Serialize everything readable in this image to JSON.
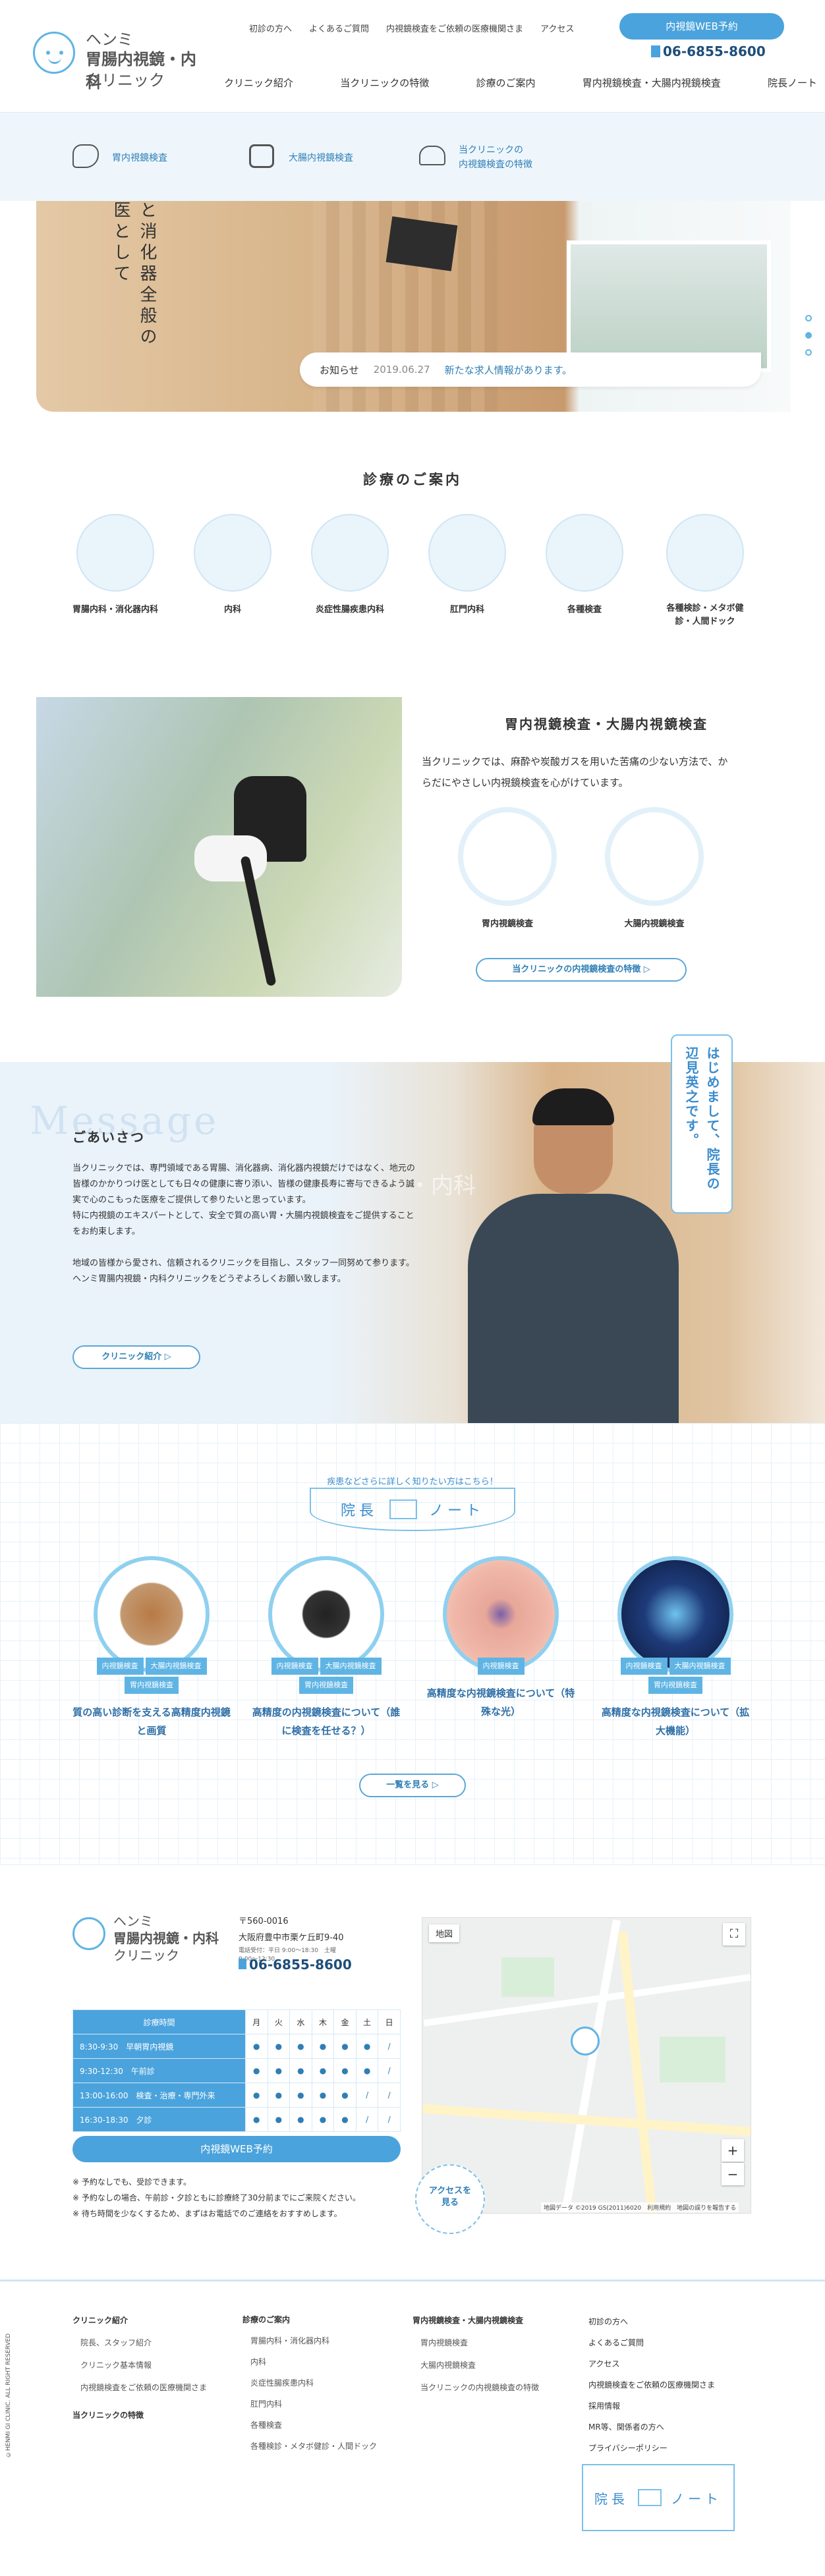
{
  "header": {
    "logo_line1": "ヘンミ",
    "logo_line2": "胃腸内視鏡・内科",
    "logo_line3": "クリニック",
    "top_links": [
      "初診の方へ",
      "よくあるご質問",
      "内視鏡検査をご依頼の医療機関さま",
      "アクセス"
    ],
    "web_button": "内視鏡WEB予約",
    "phone": "06-6855-8600",
    "nav": [
      "クリニック紹介",
      "当クリニックの特徴",
      "診療のご案内",
      "胃内視鏡検査・大腸内視鏡検査",
      "院長ノート"
    ]
  },
  "subnav": [
    "胃内視鏡検査",
    "大腸内視鏡検査",
    "当クリニックの\n内視鏡検査の特徴"
  ],
  "hero": {
    "vertical_text_1": "と消化器全般の",
    "vertical_text_2": "医として",
    "news_label": "お知らせ",
    "news_date": "2019.06.27",
    "news_text": "新たな求人情報があります。"
  },
  "services": {
    "title": "診療のご案内",
    "items": [
      "胃腸内科・消化器内科",
      "内科",
      "炎症性腸疾患内科",
      "肛門内科",
      "各種検査",
      "各種検診・メタボ健診・人間ドック"
    ]
  },
  "endoscopy": {
    "title": "胃内視鏡検査・大腸内視鏡検査",
    "desc": "当クリニックでは、麻酔や炭酸ガスを用いた苦痛の少ない方法で、からだにやさしい内視鏡検査を心がけています。",
    "items": [
      "胃内視鏡検査",
      "大腸内視鏡検査"
    ],
    "button": "当クリニックの内視鏡検査の特徴"
  },
  "message": {
    "bg_word": "Message",
    "title": "ごあいさつ",
    "p1": "当クリニックでは、専門領域である胃腸、消化器病、消化器内視鏡だけではなく、地元の皆様のかかりつけ医としても日々の健康に寄り添い、皆様の健康長寿に寄与できるよう誠実で心のこもった医療をご提供して参りたいと思っています。",
    "p2": "特に内視鏡のエキスパートとして、安全で質の高い胃・大腸内視鏡検査をご提供することをお約束します。",
    "p3": "地域の皆様から愛され、信頼されるクリニックを目指し、スタッフ一同努めて参ります。",
    "p4": "ヘンミ胃腸内視鏡・内科クリニックをどうぞよろしくお願い致します。",
    "button": "クリニック紹介",
    "bubble": "はじめまして、院長の辺見英之です。",
    "sign": "・内科"
  },
  "note": {
    "tagline": "疾患などさらに詳しく知りたい方はこちら！",
    "title_a": "院長",
    "title_b": "ノート",
    "more_button": "一覧を見る",
    "posts": [
      {
        "tags": [
          "内視鏡検査",
          "大腸内視鏡検査",
          "胃内視鏡検査"
        ],
        "title": "質の高い診断を支える高精度内視鏡と画質"
      },
      {
        "tags": [
          "内視鏡検査",
          "大腸内視鏡検査",
          "胃内視鏡検査"
        ],
        "title": "高精度の内視鏡検査について（誰に検査を任せる？）"
      },
      {
        "tags": [
          "内視鏡検査"
        ],
        "title": "高精度な内視鏡検査について（特殊な光）"
      },
      {
        "tags": [
          "内視鏡検査",
          "大腸内視鏡検査",
          "胃内視鏡検査"
        ],
        "title": "高精度な内視鏡検査について（拡大機能）"
      }
    ]
  },
  "access": {
    "postal": "〒560-0016",
    "address": "大阪府豊中市栗ケ丘町9-40",
    "phone_label": "電話受付：平日 9:00〜18:30　土曜 9:00〜12:30",
    "phone": "06-6855-8600",
    "table_header": [
      "診療時間",
      "月",
      "火",
      "水",
      "木",
      "金",
      "土",
      "日"
    ],
    "rows": [
      {
        "time": "8:30-9:30　早朝胃内視鏡",
        "marks": [
          "●",
          "●",
          "●",
          "●",
          "●",
          "●",
          "/"
        ]
      },
      {
        "time": "9:30-12:30　午前診",
        "marks": [
          "●",
          "●",
          "●",
          "●",
          "●",
          "●",
          "/"
        ]
      },
      {
        "time": "13:00-16:00　検査・治療・専門外来",
        "marks": [
          "●",
          "●",
          "●",
          "●",
          "●",
          "/",
          "/"
        ]
      },
      {
        "time": "16:30-18:30　夕診",
        "marks": [
          "●",
          "●",
          "●",
          "●",
          "●",
          "/",
          "/"
        ]
      }
    ],
    "web_button": "内視鏡WEB予約",
    "notes": [
      "※ 予約なしでも、受診できます。",
      "※ 予約なしの場合、午前診・夕診ともに診療終了30分前までにご来院ください。",
      "※ 待ち時間を少なくするため、まずはお電話でのご連絡をおすすめします。"
    ],
    "map_label": "地図",
    "access_badge": "アクセスを見る",
    "map_credit": "地図データ ©2019 GS(2011)6020　利用規約　地図の誤りを報告する"
  },
  "footer": {
    "copyright": "©HENMI GI CLINIC. ALL RIGHT RESERVED",
    "col1_title": "クリニック紹介",
    "col1": [
      "院長、スタッフ紹介",
      "クリニック基本情報",
      "内視鏡検査をご依頼の医療機関さま"
    ],
    "col1_title2": "当クリニックの特徴",
    "col2_title": "診療のご案内",
    "col2": [
      "胃腸内科・消化器内科",
      "内科",
      "炎症性腸疾患内科",
      "肛門内科",
      "各種検査",
      "各種検診・メタボ健診・人間ドック"
    ],
    "col3_title": "胃内視鏡検査・大腸内視鏡検査",
    "col3": [
      "胃内視鏡検査",
      "大腸内視鏡検査",
      "当クリニックの内視鏡検査の特徴"
    ],
    "col4": [
      "初診の方へ",
      "よくあるご質問",
      "アクセス",
      "内視鏡検査をご依頼の医療機関さま",
      "採用情報",
      "MR等、関係者の方へ",
      "プライバシーポリシー"
    ],
    "note_a": "院長",
    "note_b": "ノート"
  }
}
